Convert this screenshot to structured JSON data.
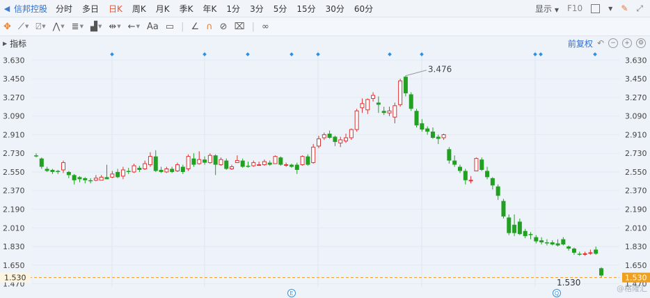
{
  "topbar": {
    "stock_name": "信邦控股",
    "periods": [
      "分时",
      "多日",
      "日K",
      "周K",
      "月K",
      "季K",
      "年K",
      "1分",
      "3分",
      "5分",
      "15分",
      "30分",
      "60分"
    ],
    "active_period": "日K",
    "display_label": "显示",
    "f10_label": "F10"
  },
  "toolbar": {
    "text_tool": "Aa"
  },
  "indicator": {
    "label": "指标",
    "adjust_label": "前复权"
  },
  "chart_data": {
    "type": "candlestick",
    "y_ticks": [
      "3.630",
      "3.450",
      "3.270",
      "3.090",
      "2.910",
      "2.730",
      "2.550",
      "2.370",
      "2.190",
      "2.010",
      "1.830",
      "1.650",
      "1.470"
    ],
    "ylim": [
      1.44,
      3.7
    ],
    "current_price": "1.530",
    "high_label": "3.476",
    "low_label": "1.530",
    "colors": {
      "up": "#e03030",
      "down": "#22a022",
      "dashed": "#f0a020"
    },
    "event_markers": [
      "E",
      "Q"
    ],
    "candles": [
      [
        2.71,
        2.7,
        2.73,
        2.69
      ],
      [
        2.68,
        2.6,
        2.69,
        2.58
      ],
      [
        2.58,
        2.56,
        2.6,
        2.55
      ],
      [
        2.57,
        2.55,
        2.58,
        2.53
      ],
      [
        2.56,
        2.55,
        2.57,
        2.53
      ],
      [
        2.57,
        2.64,
        2.66,
        2.54
      ],
      [
        2.55,
        2.52,
        2.56,
        2.49
      ],
      [
        2.52,
        2.47,
        2.53,
        2.43
      ],
      [
        2.5,
        2.48,
        2.51,
        2.45
      ],
      [
        2.49,
        2.47,
        2.5,
        2.44
      ],
      [
        2.47,
        2.46,
        2.49,
        2.44
      ],
      [
        2.47,
        2.49,
        2.52,
        2.46
      ],
      [
        2.47,
        2.5,
        2.52,
        2.47
      ],
      [
        2.5,
        2.48,
        2.62,
        2.48
      ],
      [
        2.5,
        2.53,
        2.56,
        2.49
      ],
      [
        2.55,
        2.5,
        2.58,
        2.49
      ],
      [
        2.51,
        2.57,
        2.6,
        2.48
      ],
      [
        2.56,
        2.55,
        2.59,
        2.53
      ],
      [
        2.55,
        2.61,
        2.63,
        2.54
      ],
      [
        2.59,
        2.57,
        2.61,
        2.55
      ],
      [
        2.58,
        2.63,
        2.66,
        2.57
      ],
      [
        2.62,
        2.7,
        2.74,
        2.6
      ],
      [
        2.7,
        2.56,
        2.76,
        2.55
      ],
      [
        2.57,
        2.55,
        2.6,
        2.54
      ],
      [
        2.55,
        2.58,
        2.6,
        2.54
      ],
      [
        2.58,
        2.55,
        2.6,
        2.54
      ],
      [
        2.56,
        2.62,
        2.64,
        2.55
      ],
      [
        2.6,
        2.55,
        2.62,
        2.53
      ],
      [
        2.58,
        2.7,
        2.72,
        2.56
      ],
      [
        2.68,
        2.62,
        2.73,
        2.6
      ],
      [
        2.63,
        2.67,
        2.75,
        2.62
      ],
      [
        2.67,
        2.64,
        2.7,
        2.62
      ],
      [
        2.64,
        2.71,
        2.73,
        2.63
      ],
      [
        2.71,
        2.62,
        2.72,
        2.52
      ],
      [
        2.62,
        2.67,
        2.69,
        2.61
      ],
      [
        2.66,
        2.58,
        2.68,
        2.57
      ],
      [
        2.58,
        2.6,
        2.62,
        2.57
      ],
      [
        2.64,
        2.66,
        2.71,
        2.64
      ],
      [
        2.66,
        2.6,
        2.68,
        2.59
      ],
      [
        2.61,
        2.6,
        2.65,
        2.59
      ],
      [
        2.61,
        2.64,
        2.66,
        2.6
      ],
      [
        2.62,
        2.62,
        2.65,
        2.61
      ],
      [
        2.62,
        2.65,
        2.67,
        2.61
      ],
      [
        2.64,
        2.62,
        2.66,
        2.61
      ],
      [
        2.63,
        2.7,
        2.71,
        2.63
      ],
      [
        2.69,
        2.62,
        2.7,
        2.61
      ],
      [
        2.62,
        2.62,
        2.64,
        2.6
      ],
      [
        2.62,
        2.6,
        2.63,
        2.59
      ],
      [
        2.62,
        2.57,
        2.64,
        2.53
      ],
      [
        2.62,
        2.7,
        2.71,
        2.61
      ],
      [
        2.7,
        2.62,
        2.72,
        2.61
      ],
      [
        2.64,
        2.79,
        2.82,
        2.63
      ],
      [
        2.8,
        2.87,
        2.9,
        2.78
      ],
      [
        2.88,
        2.91,
        2.93,
        2.86
      ],
      [
        2.92,
        2.88,
        2.95,
        2.87
      ],
      [
        2.89,
        2.84,
        2.9,
        2.8
      ],
      [
        2.83,
        2.86,
        2.89,
        2.79
      ],
      [
        2.85,
        2.88,
        2.92,
        2.83
      ],
      [
        2.88,
        2.96,
        2.97,
        2.86
      ],
      [
        2.96,
        3.14,
        3.16,
        2.94
      ],
      [
        3.17,
        3.21,
        3.26,
        3.12
      ],
      [
        3.15,
        3.25,
        3.26,
        3.11
      ],
      [
        3.26,
        3.29,
        3.32,
        3.23
      ],
      [
        3.22,
        3.2,
        3.28,
        3.12
      ],
      [
        3.14,
        3.12,
        3.18,
        3.1
      ],
      [
        3.12,
        3.14,
        3.18,
        3.09
      ],
      [
        3.08,
        3.19,
        3.22,
        3.02
      ],
      [
        3.2,
        3.43,
        3.45,
        3.18
      ],
      [
        3.47,
        3.31,
        3.48,
        3.28
      ],
      [
        3.3,
        3.16,
        3.32,
        3.14
      ],
      [
        3.14,
        3.0,
        3.16,
        2.98
      ],
      [
        3.02,
        2.96,
        3.06,
        2.94
      ],
      [
        2.97,
        2.94,
        2.99,
        2.91
      ],
      [
        2.94,
        2.88,
        2.98,
        2.87
      ],
      [
        2.89,
        2.87,
        2.91,
        2.82
      ],
      [
        2.88,
        2.91,
        2.92,
        2.86
      ],
      [
        2.77,
        2.66,
        2.79,
        2.63
      ],
      [
        2.66,
        2.62,
        2.71,
        2.6
      ],
      [
        2.6,
        2.56,
        2.62,
        2.54
      ],
      [
        2.56,
        2.47,
        2.58,
        2.43
      ],
      [
        2.47,
        2.47,
        2.51,
        2.44
      ],
      [
        2.56,
        2.68,
        2.69,
        2.56
      ],
      [
        2.67,
        2.57,
        2.69,
        2.56
      ],
      [
        2.56,
        2.5,
        2.6,
        2.48
      ],
      [
        2.49,
        2.42,
        2.5,
        2.38
      ],
      [
        2.41,
        2.32,
        2.43,
        2.28
      ],
      [
        2.27,
        2.12,
        2.29,
        2.1
      ],
      [
        2.11,
        1.96,
        2.14,
        1.94
      ],
      [
        2.04,
        1.96,
        2.14,
        1.93
      ],
      [
        2.07,
        1.95,
        2.1,
        1.94
      ],
      [
        1.98,
        1.93,
        2.0,
        1.91
      ],
      [
        1.95,
        1.94,
        1.97,
        1.9
      ],
      [
        1.92,
        1.88,
        1.94,
        1.86
      ],
      [
        1.89,
        1.87,
        1.92,
        1.85
      ],
      [
        1.87,
        1.86,
        1.9,
        1.84
      ],
      [
        1.87,
        1.85,
        1.89,
        1.84
      ],
      [
        1.86,
        1.84,
        1.9,
        1.83
      ],
      [
        1.9,
        1.85,
        1.92,
        1.84
      ],
      [
        1.83,
        1.81,
        1.84,
        1.79
      ],
      [
        1.81,
        1.77,
        1.82,
        1.75
      ],
      [
        1.76,
        1.75,
        1.78,
        1.74
      ],
      [
        1.76,
        1.76,
        1.78,
        1.74
      ],
      [
        1.77,
        1.77,
        1.8,
        1.75
      ],
      [
        1.8,
        1.76,
        1.83,
        1.75
      ],
      [
        1.62,
        1.55,
        1.63,
        1.53
      ]
    ]
  }
}
